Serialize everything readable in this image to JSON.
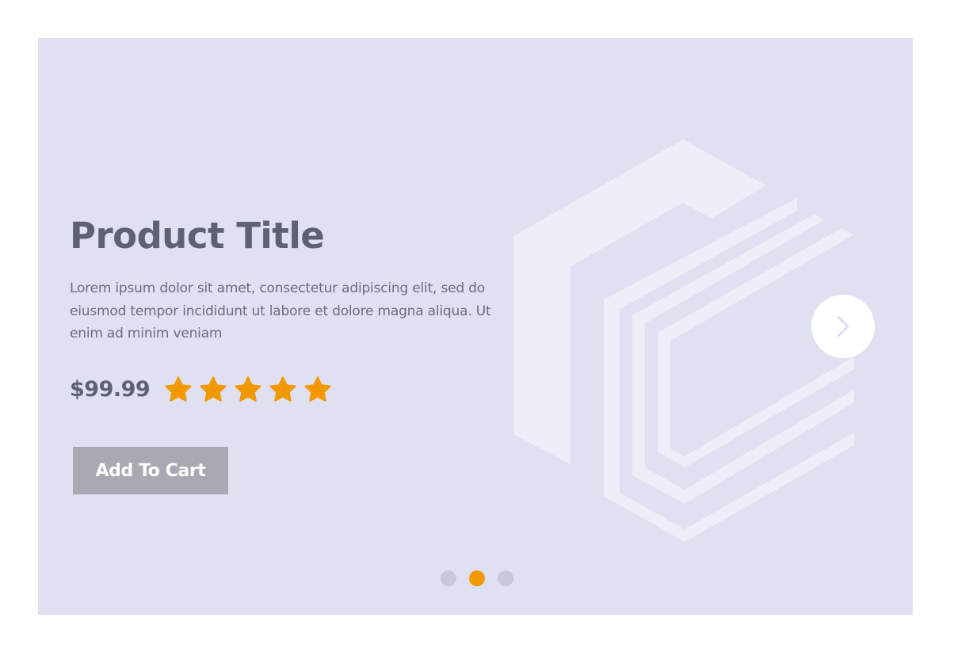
{
  "product": {
    "title": "Product Title",
    "description": "Lorem ipsum dolor sit amet, consectetur adipiscing elit, sed do eiusmod tempor incididunt ut labore et dolore magna aliqua. Ut enim ad minim veniam",
    "price": "$99.99",
    "rating": {
      "value": 5,
      "max": 5
    }
  },
  "actions": {
    "add_to_cart_label": "Add To Cart"
  },
  "pagination": {
    "count": 3,
    "active_index": 1
  },
  "icons": {
    "next": "chevron-right-icon",
    "star": "star-icon",
    "product_image": "hexagon-logo-icon"
  },
  "colors": {
    "background": "#e0e0f3",
    "accent": "#f29800",
    "button": "#a9a9b4",
    "text": "#5e6170",
    "dot_inactive": "#c8c9d8"
  }
}
